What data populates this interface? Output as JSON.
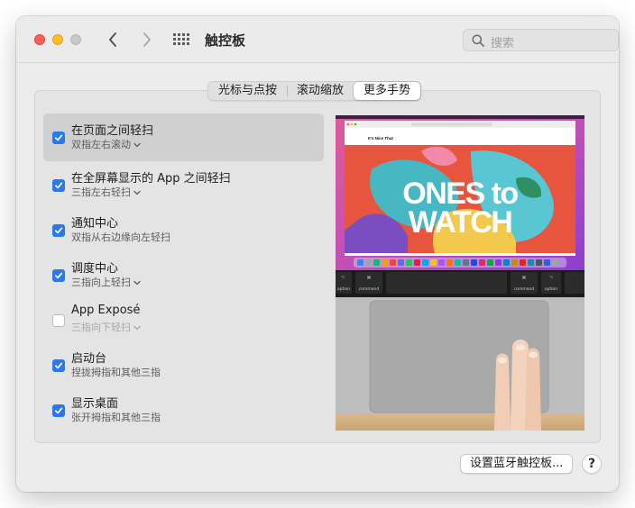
{
  "window": {
    "title": "触控板"
  },
  "search": {
    "placeholder": "搜索"
  },
  "tabs": [
    {
      "label": "光标与点按",
      "active": false
    },
    {
      "label": "滚动缩放",
      "active": false
    },
    {
      "label": "更多手势",
      "active": true
    }
  ],
  "gestures": [
    {
      "title": "在页面之间轻扫",
      "subtitle": "双指左右滚动",
      "checked": true,
      "selected": true,
      "has_menu": true
    },
    {
      "title": "在全屏幕显示的 App 之间轻扫",
      "subtitle": "三指左右轻扫",
      "checked": true,
      "selected": false,
      "has_menu": true
    },
    {
      "title": "通知中心",
      "subtitle": "双指从右边缘向左轻扫",
      "checked": true,
      "selected": false,
      "has_menu": false
    },
    {
      "title": "调度中心",
      "subtitle": "三指向上轻扫",
      "checked": true,
      "selected": false,
      "has_menu": true
    },
    {
      "title": "App Exposé",
      "subtitle": "三指向下轻扫",
      "checked": false,
      "selected": false,
      "has_menu": true
    },
    {
      "title": "启动台",
      "subtitle": "捏拢拇指和其他三指",
      "checked": true,
      "selected": false,
      "has_menu": false
    },
    {
      "title": "显示桌面",
      "subtitle": "张开拇指和其他三指",
      "checked": true,
      "selected": false,
      "has_menu": false
    }
  ],
  "preview": {
    "site_name": "It's Nice That",
    "headline_line1": "ONES to",
    "headline_line2": "WATCH",
    "key_option_left": "option",
    "key_command_left": "command",
    "key_command_right": "command",
    "key_option_right": "option",
    "key_symbol_cmd": "⌘",
    "key_symbol_opt": "⌥"
  },
  "footer": {
    "bluetooth_button": "设置蓝牙触控板...",
    "help": "?"
  },
  "colors": {
    "accent": "#2a7aef",
    "red": "#fe5f57",
    "yellow": "#febc2e"
  }
}
